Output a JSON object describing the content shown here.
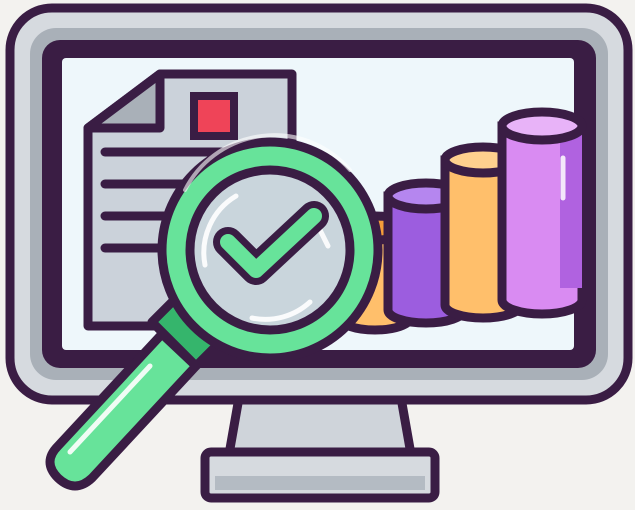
{
  "illustration": {
    "subject": "monitor-with-report-and-magnifier",
    "icons": [
      "monitor-icon",
      "document-icon",
      "bar-chart-icon",
      "magnifying-glass-icon",
      "checkmark-icon"
    ],
    "colors": {
      "outline": "#3a1d44",
      "bezel_outer": "#d6dadf",
      "bezel_inner": "#a9b0b8",
      "screen": "#eef7fb",
      "document": "#cbd2da",
      "document_lines": "#3a1d44",
      "document_stamp": "#ef4458",
      "bar_orange": "#ffbf6b",
      "bar_orange_dark": "#f59d3a",
      "bar_purple": "#9c5ddf",
      "bar_purple_dark": "#7a3fc4",
      "bar_violet": "#d98bf2",
      "bar_violet_dark": "#b062e0",
      "lens_ring": "#67e39a",
      "lens_ring_dark": "#35b56c",
      "lens_glass": "#c9d5dc",
      "check": "#67e39a",
      "stand": "#d6dadf",
      "background": "#f3f2ef"
    }
  }
}
